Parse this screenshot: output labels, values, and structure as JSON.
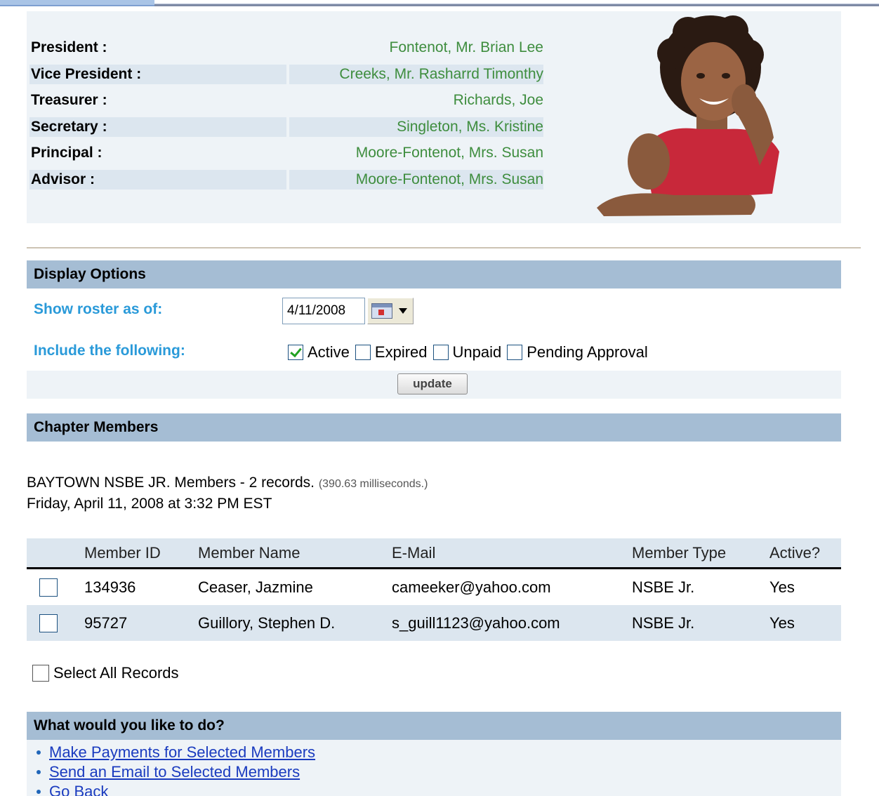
{
  "officers": [
    {
      "label": "President :",
      "value": "Fontenot, Mr. Brian Lee"
    },
    {
      "label": "Vice President :",
      "value": "Creeks, Mr. Rasharrd Timonthy"
    },
    {
      "label": "Treasurer :",
      "value": "Richards, Joe"
    },
    {
      "label": "Secretary :",
      "value": "Singleton, Ms. Kristine"
    },
    {
      "label": "Principal :",
      "value": "Moore-Fontenot, Mrs. Susan"
    },
    {
      "label": "Advisor :",
      "value": "Moore-Fontenot, Mrs. Susan"
    }
  ],
  "display_options": {
    "header": "Display Options",
    "roster_label": "Show roster as of:",
    "roster_date": "4/11/2008",
    "include_label": "Include the following:",
    "filters": [
      {
        "label": "Active",
        "checked": true
      },
      {
        "label": "Expired",
        "checked": false
      },
      {
        "label": "Unpaid",
        "checked": false
      },
      {
        "label": "Pending Approval",
        "checked": false
      }
    ],
    "update_label": "update"
  },
  "chapter_members": {
    "header": "Chapter Members",
    "summary_line": "BAYTOWN NSBE JR. Members - 2 records.",
    "timing": "(390.63 milliseconds.)",
    "timestamp": "Friday, April 11, 2008 at 3:32 PM EST",
    "columns": [
      "Member ID",
      "Member Name",
      "E-Mail",
      "Member Type",
      "Active?"
    ],
    "rows": [
      {
        "id": "134936",
        "name": "Ceaser, Jazmine",
        "email": "cameeker@yahoo.com",
        "type": "NSBE Jr.",
        "active": "Yes"
      },
      {
        "id": "95727",
        "name": "Guillory, Stephen D.",
        "email": "s_guill1123@yahoo.com",
        "type": "NSBE Jr.",
        "active": "Yes"
      }
    ],
    "select_all_label": "Select All Records"
  },
  "actions": {
    "header": "What would you like to do?",
    "links": [
      "Make Payments for Selected Members",
      "Send an Email to Selected Members",
      "Go Back"
    ]
  },
  "colors": {
    "section_header_bg": "#a5bdd4",
    "officer_value": "#3e8d3e",
    "option_label": "#2a9ad9",
    "link": "#1a3bbf"
  }
}
